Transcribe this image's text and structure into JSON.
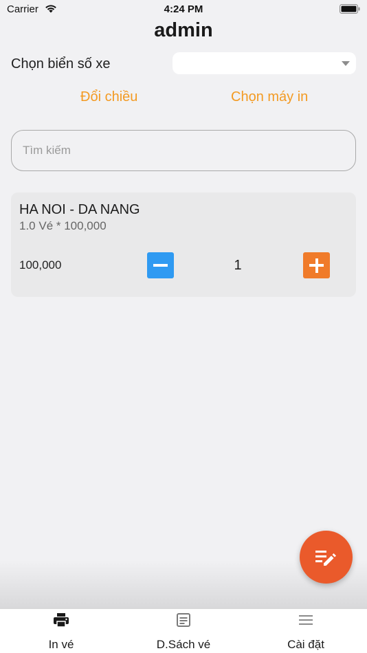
{
  "status_bar": {
    "carrier": "Carrier",
    "time": "4:24 PM"
  },
  "header": {
    "title": "admin"
  },
  "plate": {
    "label": "Chọn biển số xe",
    "selected_value": ""
  },
  "actions": {
    "swap_direction": "Đổi chiều",
    "choose_printer": "Chọn máy in"
  },
  "search": {
    "placeholder": "Tìm kiếm",
    "value": ""
  },
  "tickets": [
    {
      "route": "HA NOI - DA NANG",
      "formula": "1.0 Vé * 100,000",
      "price": "100,000",
      "quantity": "1"
    }
  ],
  "tabs": [
    {
      "label": "In vé",
      "icon": "printer-icon",
      "active": true
    },
    {
      "label": "D.Sách vé",
      "icon": "ticket-list-icon",
      "active": false
    },
    {
      "label": "Cài đặt",
      "icon": "menu-icon",
      "active": false
    }
  ],
  "colors": {
    "accent_orange": "#f39a22",
    "fab": "#ea5a2b",
    "minus_button": "#2f9af2",
    "plus_button": "#f07b2a",
    "background": "#f1f1f3"
  }
}
